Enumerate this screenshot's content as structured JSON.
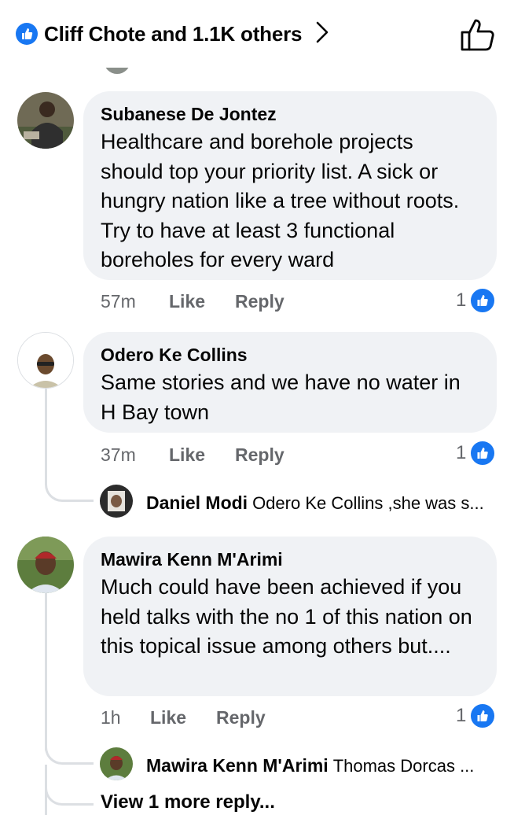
{
  "header": {
    "reactions_text": "Cliff Chote and 1.1K others"
  },
  "colors": {
    "accent": "#1877f2",
    "bubble": "#f0f2f5",
    "secondary_text": "#65676b"
  },
  "comments": [
    {
      "author": "Subanese De Jontez",
      "text": "Healthcare and borehole projects should top your priority list. A sick or hungry nation like a tree without roots. Try to have at least 3 functional boreholes for every ward",
      "time": "57m",
      "like_label": "Like",
      "reply_label": "Reply",
      "reaction_count": "1"
    },
    {
      "author": "Odero Ke Collins",
      "text": "Same stories and we have no water in H Bay town",
      "time": "37m",
      "like_label": "Like",
      "reply_label": "Reply",
      "reaction_count": "1",
      "reply_preview": {
        "author": "Daniel Modi",
        "text": "Odero Ke Collins ,she was s..."
      }
    },
    {
      "author": "Mawira Kenn M'Arimi",
      "text": "Much could have been achieved if you held talks with the no 1 of this nation on this topical issue among others but....",
      "time": "1h",
      "like_label": "Like",
      "reply_label": "Reply",
      "reaction_count": "1",
      "reply_preview": {
        "author": "Mawira Kenn M'Arimi",
        "text": "Thomas Dorcas ..."
      },
      "more_replies_label": "View 1 more reply..."
    }
  ]
}
